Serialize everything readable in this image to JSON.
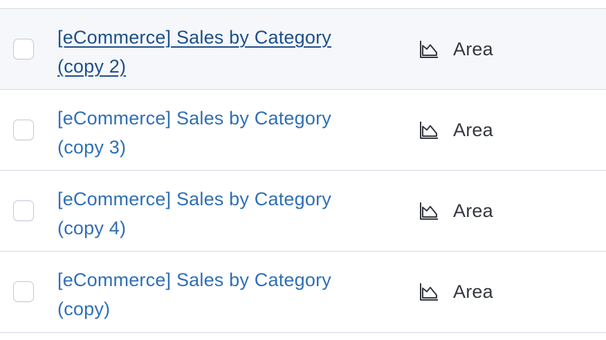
{
  "rows": [
    {
      "title": "[eCommerce] Sales by Category (copy 2)",
      "type": "Area",
      "type_icon": "area-chart-icon",
      "hovered": true
    },
    {
      "title": "[eCommerce] Sales by Category (copy 3)",
      "type": "Area",
      "type_icon": "area-chart-icon",
      "hovered": false
    },
    {
      "title": "[eCommerce] Sales by Category (copy 4)",
      "type": "Area",
      "type_icon": "area-chart-icon",
      "hovered": false
    },
    {
      "title": "[eCommerce] Sales by Category (copy)",
      "type": "Area",
      "type_icon": "area-chart-icon",
      "hovered": false
    }
  ],
  "colors": {
    "link": "#2f6fb5",
    "link_hover": "#1d4f8a",
    "text": "#343741",
    "border": "#d3dae6",
    "row_hover_bg": "#f5f7fa"
  }
}
